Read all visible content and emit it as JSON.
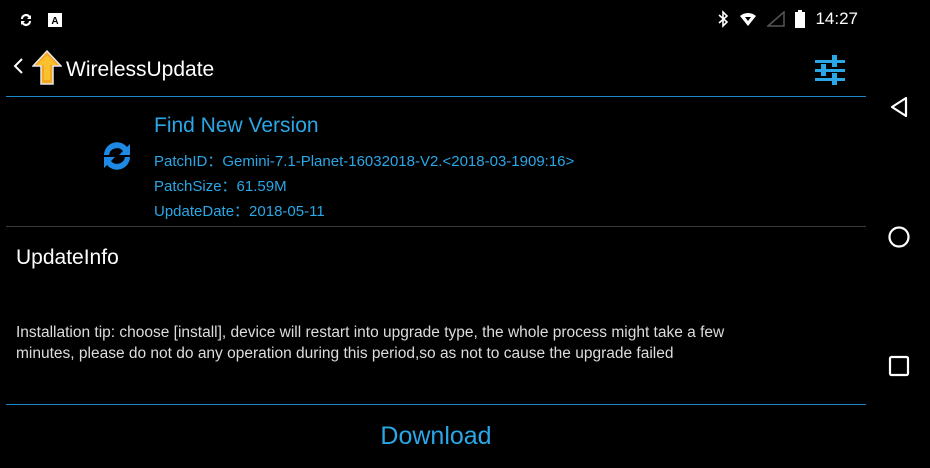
{
  "status_bar": {
    "time": "14:27",
    "left_icons": [
      "sync-icon",
      "a-notification-icon"
    ],
    "right_icons": [
      "bluetooth-icon",
      "wifi-icon",
      "signal-icon",
      "battery-icon"
    ]
  },
  "app_bar": {
    "title": "WirelessUpdate"
  },
  "version": {
    "title": "Find New Version",
    "patch_id": "PatchID：Gemini-7.1-Planet-16032018-V2.<2018-03-1909:16>",
    "patch_size": "PatchSize：61.59M",
    "update_date": "UpdateDate：2018-05-11"
  },
  "update_info": {
    "heading": "UpdateInfo",
    "tip_line1": "Installation tip: choose [install], device will restart into upgrade type, the whole process might take a few",
    "tip_line2": "minutes, please do not do any operation during this period,so as not to cause the upgrade failed"
  },
  "actions": {
    "download_label": "Download"
  },
  "colors": {
    "accent": "#2aa7e6",
    "divider": "#1e88c8",
    "logo": "#f5a623"
  }
}
